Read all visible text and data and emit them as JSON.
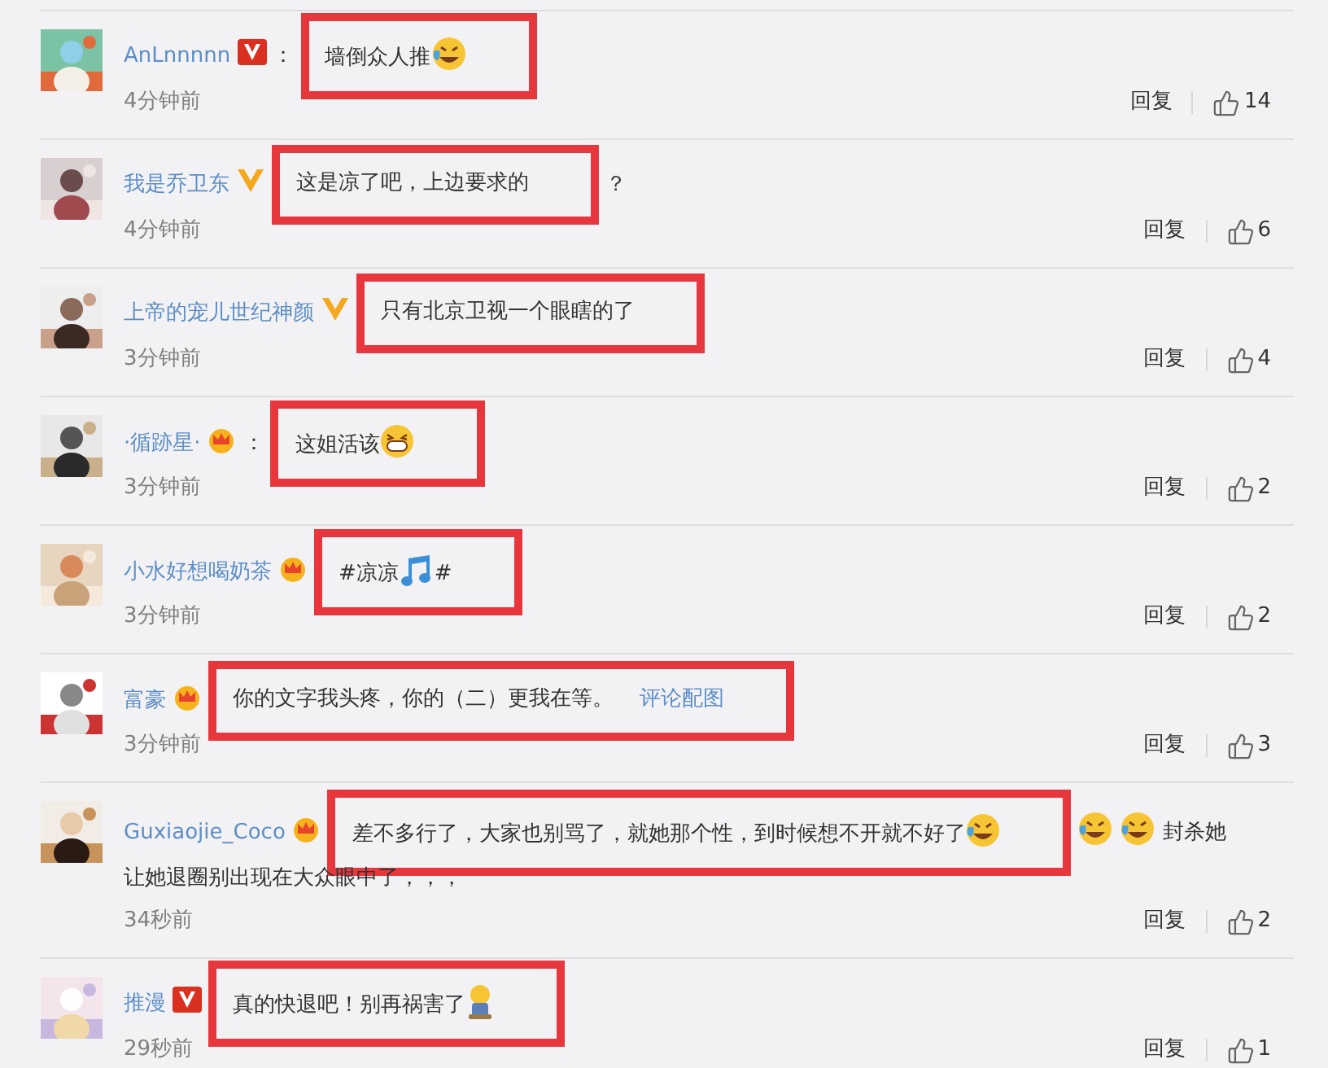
{
  "comments": [
    {
      "user": "AnLnnnnn",
      "badge": {
        "kind": "red_v"
      },
      "separator": "：",
      "highlight": [
        {
          "kind": "text",
          "text": "墙倒众人推"
        },
        {
          "kind": "laugh"
        }
      ],
      "time": "4分钟前",
      "reply": "回复",
      "likes": "14"
    },
    {
      "user": "我是乔卫东",
      "badge": {
        "kind": "gold_v"
      },
      "highlight": [
        {
          "kind": "text",
          "text": "这是凉了吧，上边要求的"
        }
      ],
      "tail": [
        {
          "kind": "text",
          "text": "？"
        }
      ],
      "time": "4分钟前",
      "reply": "回复",
      "likes": "6"
    },
    {
      "user": "上帝的宠儿世纪神颜",
      "badge": {
        "kind": "gold_v"
      },
      "highlight": [
        {
          "kind": "text",
          "text": "只有北京卫视一个眼瞎的了"
        }
      ],
      "time": "3分钟前",
      "reply": "回复",
      "likes": "4"
    },
    {
      "user": "·循跡星·",
      "badge": {
        "kind": "crown"
      },
      "separator": "：",
      "highlight": [
        {
          "kind": "text",
          "text": "这姐活该"
        },
        {
          "kind": "grin"
        }
      ],
      "time": "3分钟前",
      "reply": "回复",
      "likes": "2"
    },
    {
      "user": "小水好想喝奶茶",
      "badge": {
        "kind": "crown"
      },
      "highlight": [
        {
          "kind": "text",
          "text": "#凉凉"
        },
        {
          "kind": "music"
        },
        {
          "kind": "text",
          "text": "#"
        }
      ],
      "time": "3分钟前",
      "reply": "回复",
      "likes": "2"
    },
    {
      "user": "富豪",
      "badge": {
        "kind": "crown"
      },
      "highlight": [
        {
          "kind": "text",
          "text": "你的文字我头疼，你的（二）更我在等。"
        },
        {
          "kind": "link",
          "text": "评论配图"
        }
      ],
      "time": "3分钟前",
      "reply": "回复",
      "likes": "3"
    },
    {
      "user": "Guxiaojie_Coco",
      "badge": {
        "kind": "crown"
      },
      "highlight": [
        {
          "kind": "text",
          "text": "差不多行了，大家也别骂了，就她那个性，到时候想不开就不好了"
        },
        {
          "kind": "laugh"
        }
      ],
      "tail": [
        {
          "kind": "laugh"
        },
        {
          "kind": "laugh"
        },
        {
          "kind": "text",
          "text": "封杀她"
        }
      ],
      "continuation": "让她退圈别出现在大众眼中了，，，",
      "time": "34秒前",
      "reply": "回复",
      "likes": "2"
    },
    {
      "user": "推漫",
      "badge": {
        "kind": "red_v"
      },
      "highlight": [
        {
          "kind": "text",
          "text": "真的快退吧！别再祸害了"
        },
        {
          "kind": "figure"
        }
      ],
      "time": "29秒前",
      "reply": "回复",
      "likes": "1"
    }
  ]
}
